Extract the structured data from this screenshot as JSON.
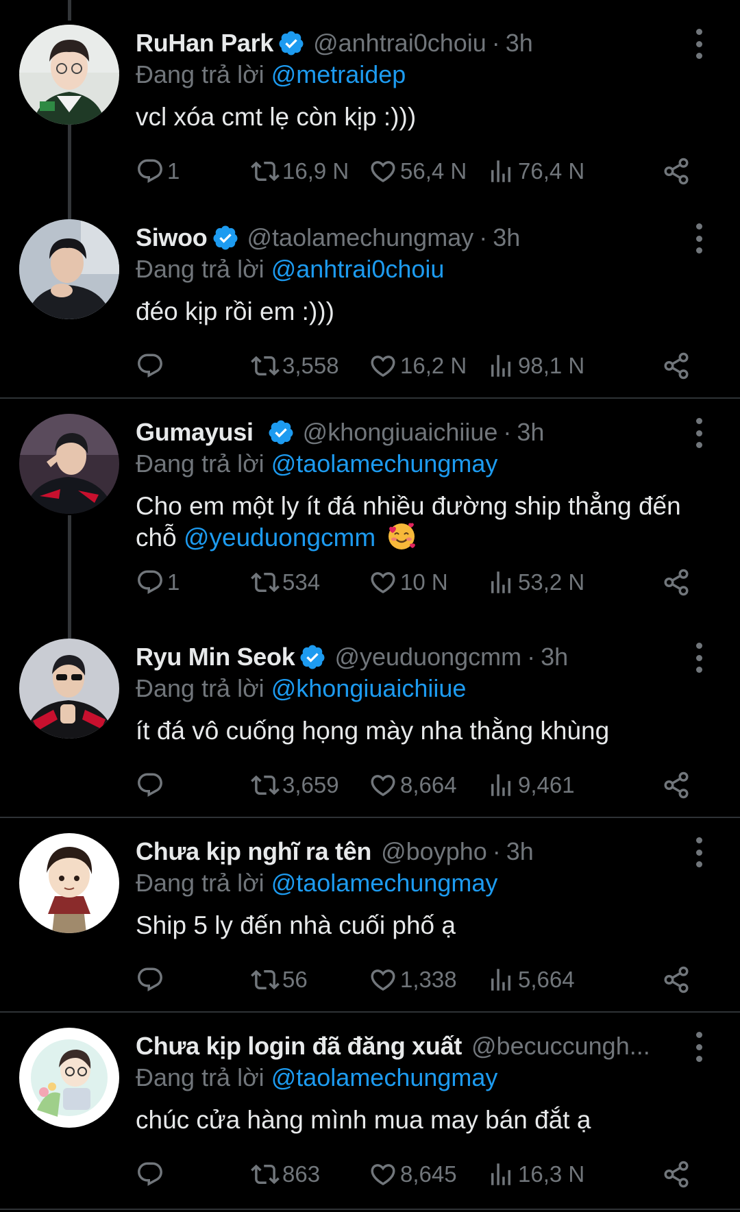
{
  "colors": {
    "background": "#000000",
    "text": "#e7e9ea",
    "secondary": "#71767b",
    "accent": "#1d9bf0"
  },
  "tweets": [
    {
      "name": "RuHan Park",
      "handle": "@anhtrai0choiu",
      "time": "3h",
      "replying_label": "Đang trả lời",
      "replying_to": "@metraidep",
      "text": "vcl xóa cmt lẹ còn kịp :)))",
      "mention": "",
      "emoji": "",
      "replies": "1",
      "retweets": "16,9 N",
      "likes": "56,4 N",
      "views": "76,4 N",
      "verified": true
    },
    {
      "name": "Siwoo",
      "handle": "@taolamechungmay",
      "time": "3h",
      "replying_label": "Đang trả lời",
      "replying_to": "@anhtrai0choiu",
      "text": "đéo kịp rồi em :)))",
      "mention": "",
      "emoji": "",
      "replies": "",
      "retweets": "3,558",
      "likes": "16,2 N",
      "views": "98,1 N",
      "verified": true
    },
    {
      "name": "Gumayusi",
      "handle": "@khongiuaichiiue",
      "time": "3h",
      "replying_label": "Đang trả lời",
      "replying_to": "@taolamechungmay",
      "text": "Cho em một ly ít đá nhiều đường ship thẳng đến chỗ ",
      "mention": "@yeuduongcmm",
      "emoji": "🥰",
      "replies": "1",
      "retweets": "534",
      "likes": "10 N",
      "views": "53,2 N",
      "verified": true
    },
    {
      "name": "Ryu Min Seok",
      "handle": "@yeuduongcmm",
      "time": "3h",
      "replying_label": "Đang trả lời",
      "replying_to": "@khongiuaichiiue",
      "text": "ít đá vô cuống họng mày nha thằng khùng",
      "mention": "",
      "emoji": "",
      "replies": "",
      "retweets": "3,659",
      "likes": "8,664",
      "views": "9,461",
      "verified": true
    },
    {
      "name": "Chưa kịp nghĩ ra tên",
      "handle": "@boypho",
      "time": "3h",
      "replying_label": "Đang trả lời",
      "replying_to": "@taolamechungmay",
      "text": "Ship 5 ly đến nhà cuối phố ạ",
      "mention": "",
      "emoji": "",
      "replies": "",
      "retweets": "56",
      "likes": "1,338",
      "views": "5,664",
      "verified": false
    },
    {
      "name": "Chưa kịp login đã đăng xuất",
      "handle": "@becuccungh...",
      "time": "",
      "replying_label": "Đang trả lời",
      "replying_to": "@taolamechungmay",
      "text": "chúc cửa hàng mình mua may bán đắt ạ",
      "mention": "",
      "emoji": "",
      "replies": "",
      "retweets": "863",
      "likes": "8,645",
      "views": "16,3 N",
      "verified": false
    }
  ]
}
